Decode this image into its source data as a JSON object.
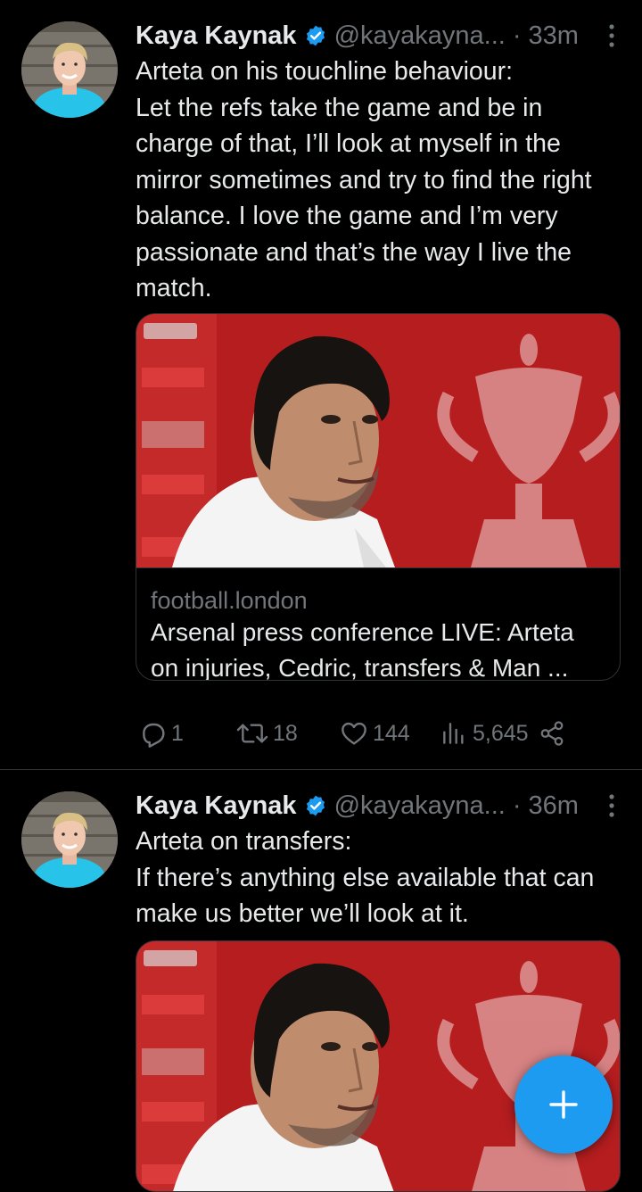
{
  "tweets": [
    {
      "author": "Kaya Kaynak",
      "handle": "@kayakayna...",
      "dot": "·",
      "time": "33m",
      "text_lines": [
        "Arteta on his touchline behaviour:",
        "Let the refs take the game and be in charge of that, I’ll look at myself in the mirror sometimes and try to find the right balance. I love the game and I’m very passionate and that’s the way I live the match."
      ],
      "card": {
        "domain": "football.london",
        "title": "Arsenal press conference LIVE: Arteta on injuries, Cedric, transfers & Man ..."
      },
      "replies": "1",
      "retweets": "18",
      "likes": "144",
      "views": "5,645"
    },
    {
      "author": "Kaya Kaynak",
      "handle": "@kayakayna...",
      "dot": "·",
      "time": "36m",
      "text_lines": [
        "Arteta on transfers:",
        "If there’s anything else available that can make us better we’ll look at it."
      ]
    }
  ],
  "icons": {
    "verified": "verified-badge-icon",
    "more": "more-vertical-icon",
    "reply": "reply-icon",
    "retweet": "retweet-icon",
    "like": "heart-icon",
    "views": "views-icon",
    "share": "share-icon",
    "compose": "plus-icon"
  },
  "colors": {
    "background": "#000000",
    "accent": "#1d9bf0",
    "secondary_text": "#71767b",
    "primary_text": "#e7e9ea"
  }
}
